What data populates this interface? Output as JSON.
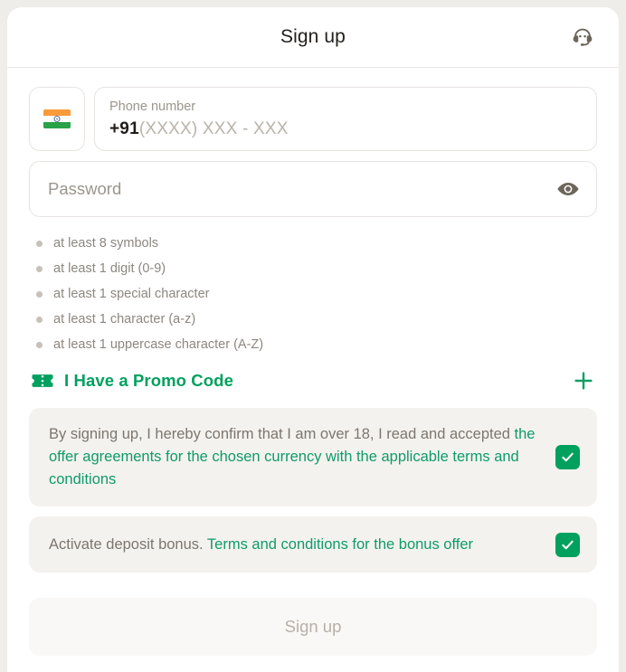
{
  "header": {
    "title": "Sign up",
    "support_icon": "headset-support-icon"
  },
  "phone": {
    "country_flag": "india-flag-icon",
    "label": "Phone number",
    "prefix": "+91",
    "placeholder": "(XXXX) XXX - XXX"
  },
  "password": {
    "placeholder": "Password",
    "toggle_icon": "eye-icon"
  },
  "requirements": [
    {
      "text": "at least 8 symbols"
    },
    {
      "text": "at least 1 digit (0-9)"
    },
    {
      "text": "at least 1 special character"
    },
    {
      "text": "at least 1 character (a-z)"
    },
    {
      "text": "at least 1 uppercase character (A-Z)"
    }
  ],
  "promo": {
    "label": "I Have a Promo Code",
    "icon": "ticket-icon",
    "expand_icon": "plus-icon"
  },
  "terms": {
    "text_before": "By signing up, I hereby confirm that I am over 18, I read and accepted ",
    "link_text": "the offer agreements for the chosen currency with the applicable terms and conditions",
    "checked": true
  },
  "bonus": {
    "text_before": "Activate deposit bonus. ",
    "link_text": "Terms and conditions for the bonus offer",
    "checked": true
  },
  "submit": {
    "label": "Sign up",
    "enabled": false
  },
  "colors": {
    "accent_green": "#00a05e",
    "link_green": "#0f9b6c",
    "page_background": "#efedea",
    "card_background": "#ffffff",
    "panel_background": "#f4f2ee",
    "muted_text": "#8d8780"
  }
}
